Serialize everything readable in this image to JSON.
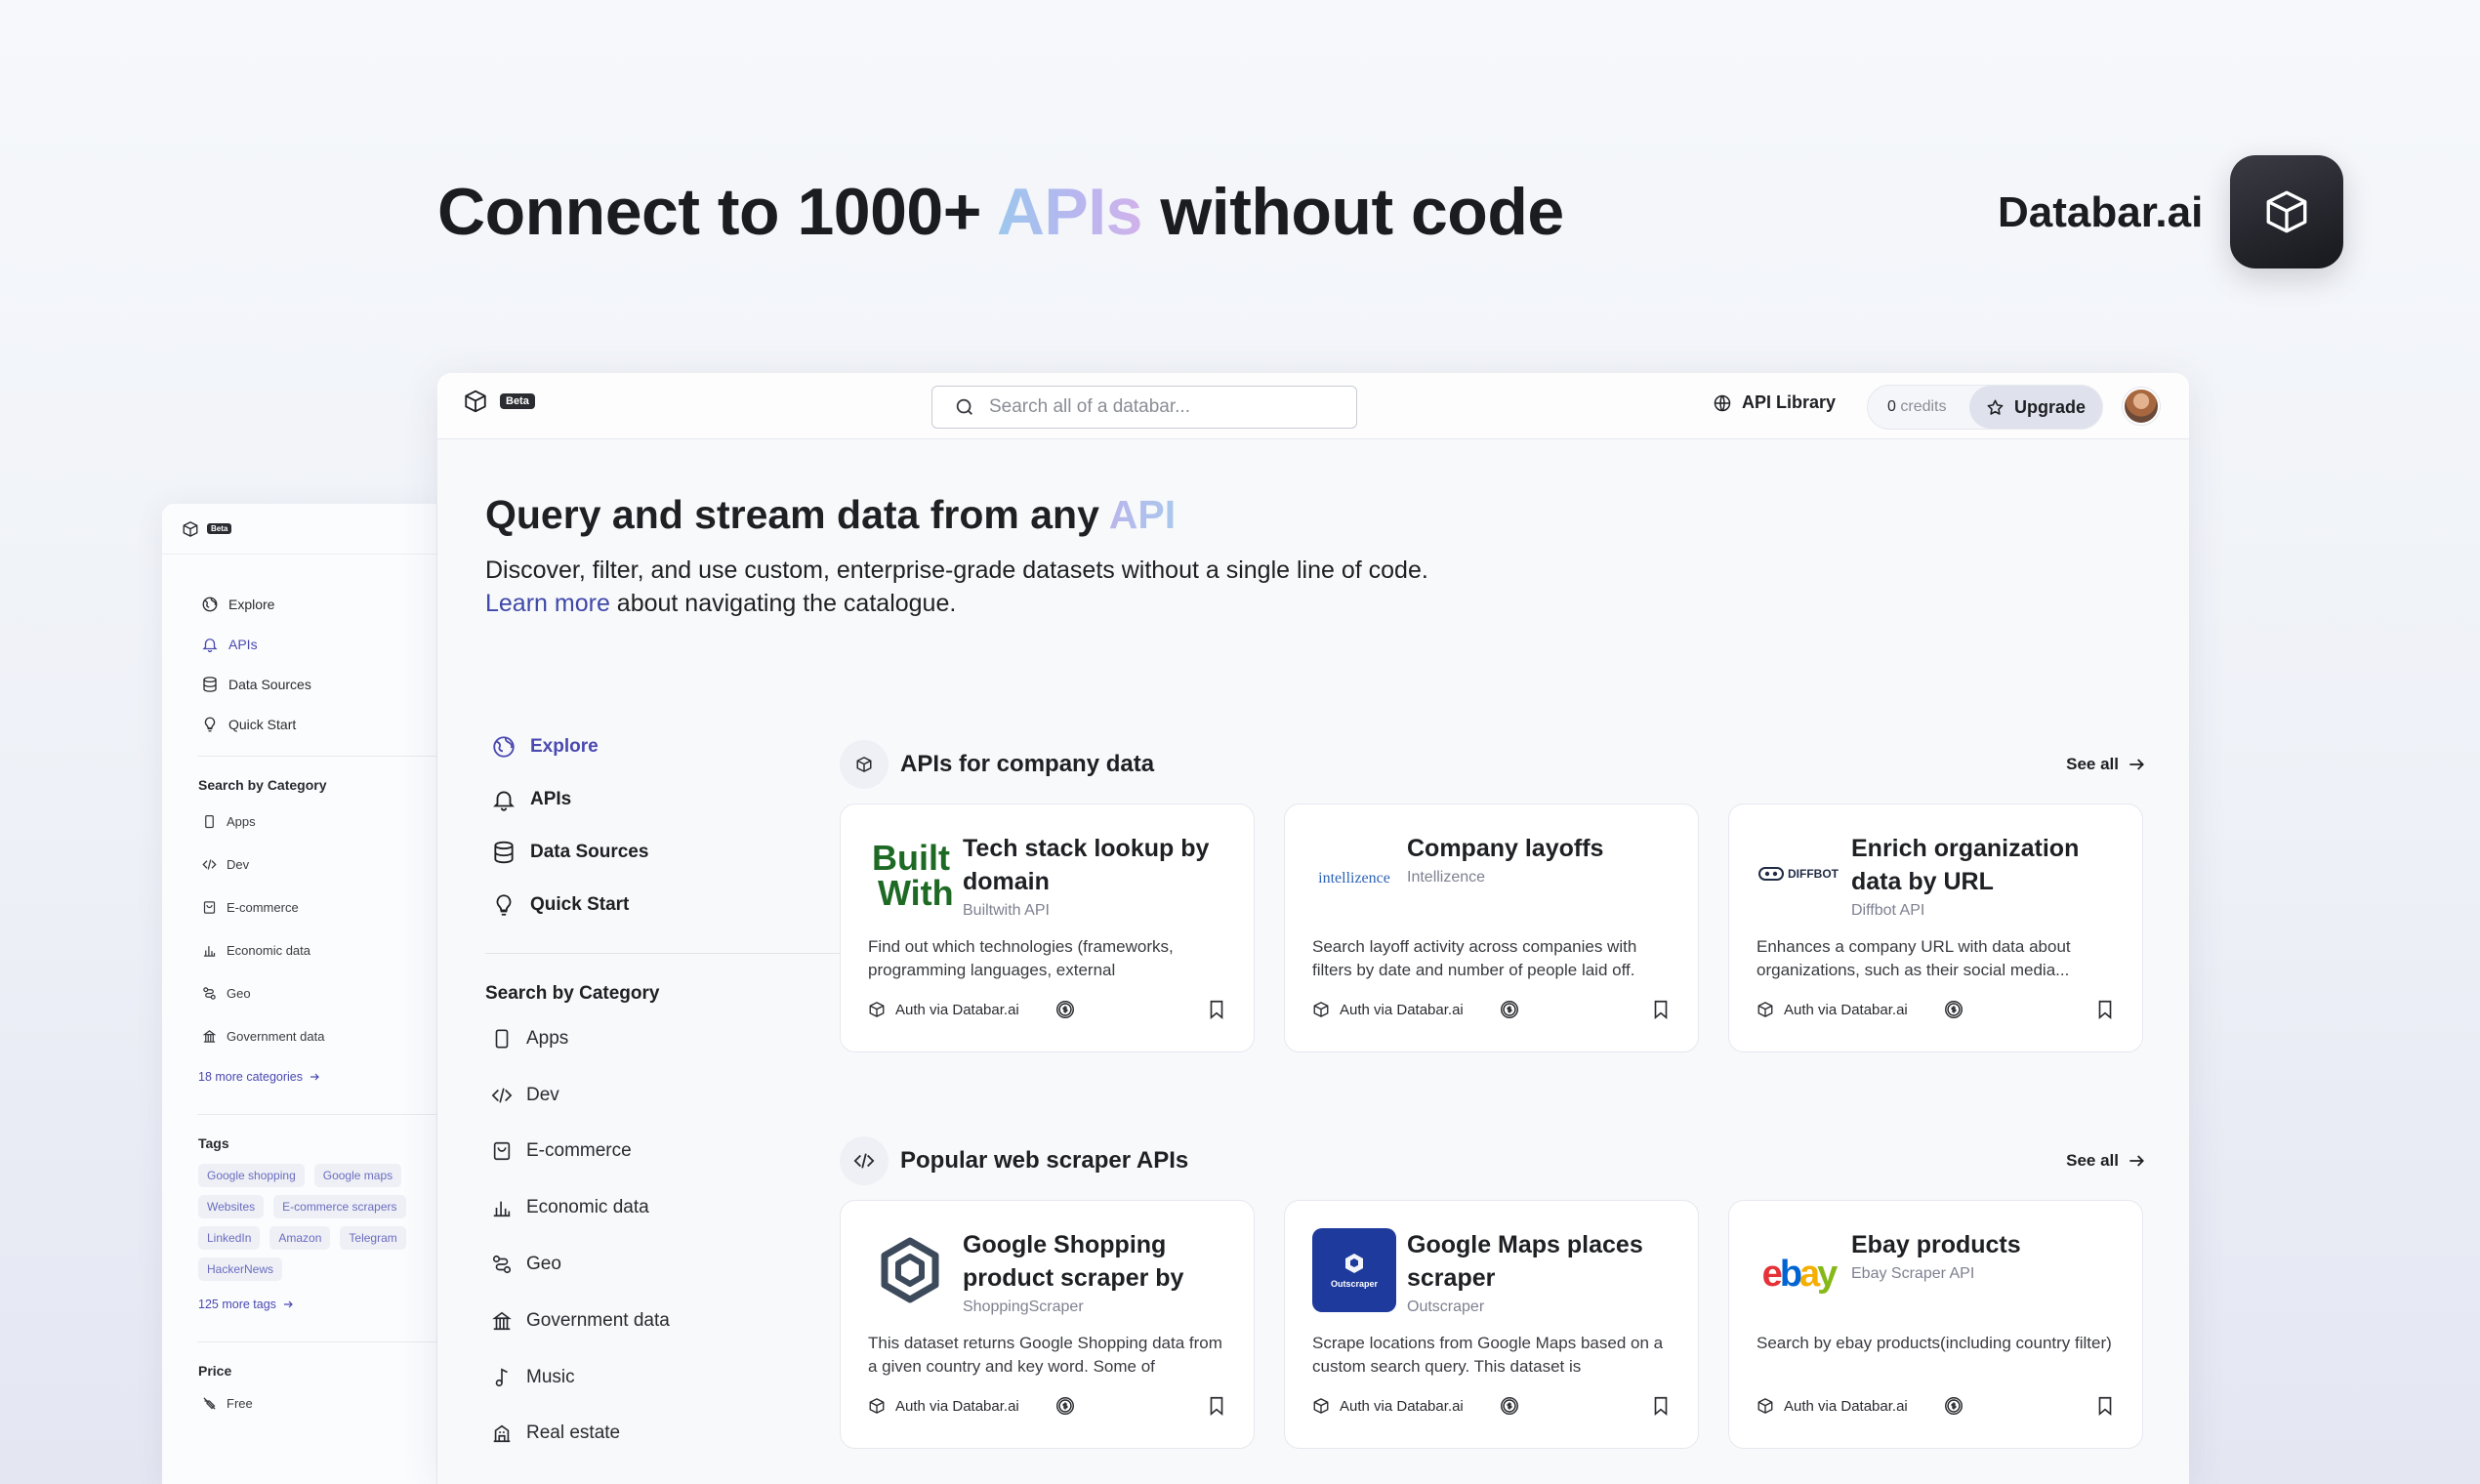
{
  "hero": {
    "title_pre": "Connect to 1000+ ",
    "title_grad": "APIs",
    "title_post": " without code",
    "brand": "Databar.ai"
  },
  "back_sidebar": {
    "beta": "Beta",
    "nav": [
      {
        "label": "Explore",
        "icon": "globe-icon",
        "active": false
      },
      {
        "label": "APIs",
        "icon": "bell-icon",
        "active": true
      },
      {
        "label": "Data Sources",
        "icon": "database-icon",
        "active": false
      },
      {
        "label": "Quick Start",
        "icon": "lightbulb-icon",
        "active": false
      }
    ],
    "category_heading": "Search by Category",
    "categories": [
      "Apps",
      "Dev",
      "E-commerce",
      "Economic data",
      "Geo",
      "Government data"
    ],
    "more_categories": "18 more categories",
    "tags_heading": "Tags",
    "tags": [
      "Google shopping",
      "Google maps",
      "Websites",
      "E-commerce scrapers",
      "LinkedIn",
      "Amazon",
      "Telegram",
      "HackerNews"
    ],
    "more_tags": "125 more tags",
    "price_heading": "Price",
    "price_free": "Free"
  },
  "topbar": {
    "beta": "Beta",
    "search_placeholder": "Search all of a databar...",
    "api_library": "API Library",
    "credits_value": "0",
    "credits_label": "credits",
    "upgrade": "Upgrade"
  },
  "main": {
    "heading_pre": "Query and stream data from any ",
    "heading_grad": "API",
    "sub_line1": "Discover, filter, and use custom, enterprise-grade datasets without a single line of code.",
    "learn_more": "Learn more",
    "sub_line2": " about navigating the catalogue."
  },
  "left_nav": {
    "items": [
      {
        "label": "Explore",
        "icon": "globe-icon",
        "active": true
      },
      {
        "label": "APIs",
        "icon": "bell-icon",
        "active": false
      },
      {
        "label": "Data Sources",
        "icon": "database-icon",
        "active": false
      },
      {
        "label": "Quick Start",
        "icon": "lightbulb-icon",
        "active": false
      }
    ],
    "category_heading": "Search by Category",
    "categories": [
      "Apps",
      "Dev",
      "E-commerce",
      "Economic data",
      "Geo",
      "Government data",
      "Music",
      "Real estate"
    ]
  },
  "sections": [
    {
      "title": "APIs for company data",
      "icon": "cube-icon",
      "see_all": "See all",
      "cards": [
        {
          "title": "Tech stack lookup by domain",
          "source": "Builtwith API",
          "desc": "Find out which technologies (frameworks, programming languages, external",
          "auth": "Auth via Databar.ai",
          "logo": "builtwith-logo",
          "logo_text": [
            "Built",
            "With"
          ]
        },
        {
          "title": "Company layoffs",
          "source": "Intellizence",
          "desc": "Search layoff activity across companies with filters by date and number of people laid off.",
          "auth": "Auth via Databar.ai",
          "logo": "intellizence-logo",
          "logo_text": [
            "intellizence"
          ]
        },
        {
          "title": "Enrich organization data by URL",
          "source": "Diffbot API",
          "desc": "Enhances a company URL with data about organizations, such as their social media...",
          "auth": "Auth via Databar.ai",
          "logo": "diffbot-logo",
          "logo_text": [
            "DIFFBOT"
          ]
        }
      ]
    },
    {
      "title": "Popular web scraper APIs",
      "icon": "code-icon",
      "see_all": "See all",
      "cards": [
        {
          "title": "Google Shopping product scraper by",
          "source": "ShoppingScraper",
          "desc": "This dataset returns Google Shopping data from a given country and key word. Some of",
          "auth": "Auth via Databar.ai",
          "logo": "shoppingscraper-logo",
          "logo_text": []
        },
        {
          "title": "Google Maps places scraper",
          "source": "Outscraper",
          "desc": "Scrape locations from Google Maps based on a custom search query. This dataset is",
          "auth": "Auth via Databar.ai",
          "logo": "outscraper-logo",
          "logo_text": [
            "Outscraper"
          ]
        },
        {
          "title": "Ebay products",
          "source": "Ebay Scraper API",
          "desc": "Search by ebay products(including country filter)",
          "auth": "Auth via Databar.ai",
          "logo": "ebay-logo",
          "logo_text": [
            "e",
            "b",
            "a",
            "y"
          ]
        }
      ]
    }
  ],
  "colors": {
    "accent": "#4a49b0",
    "link": "#3f48a8",
    "builtwith_green": "#1e6a25",
    "outscraper_blue": "#1d3a9c",
    "ebay_red": "#e53238",
    "ebay_blue": "#0064d2",
    "ebay_yellow": "#f5af02",
    "ebay_green": "#86b817"
  }
}
